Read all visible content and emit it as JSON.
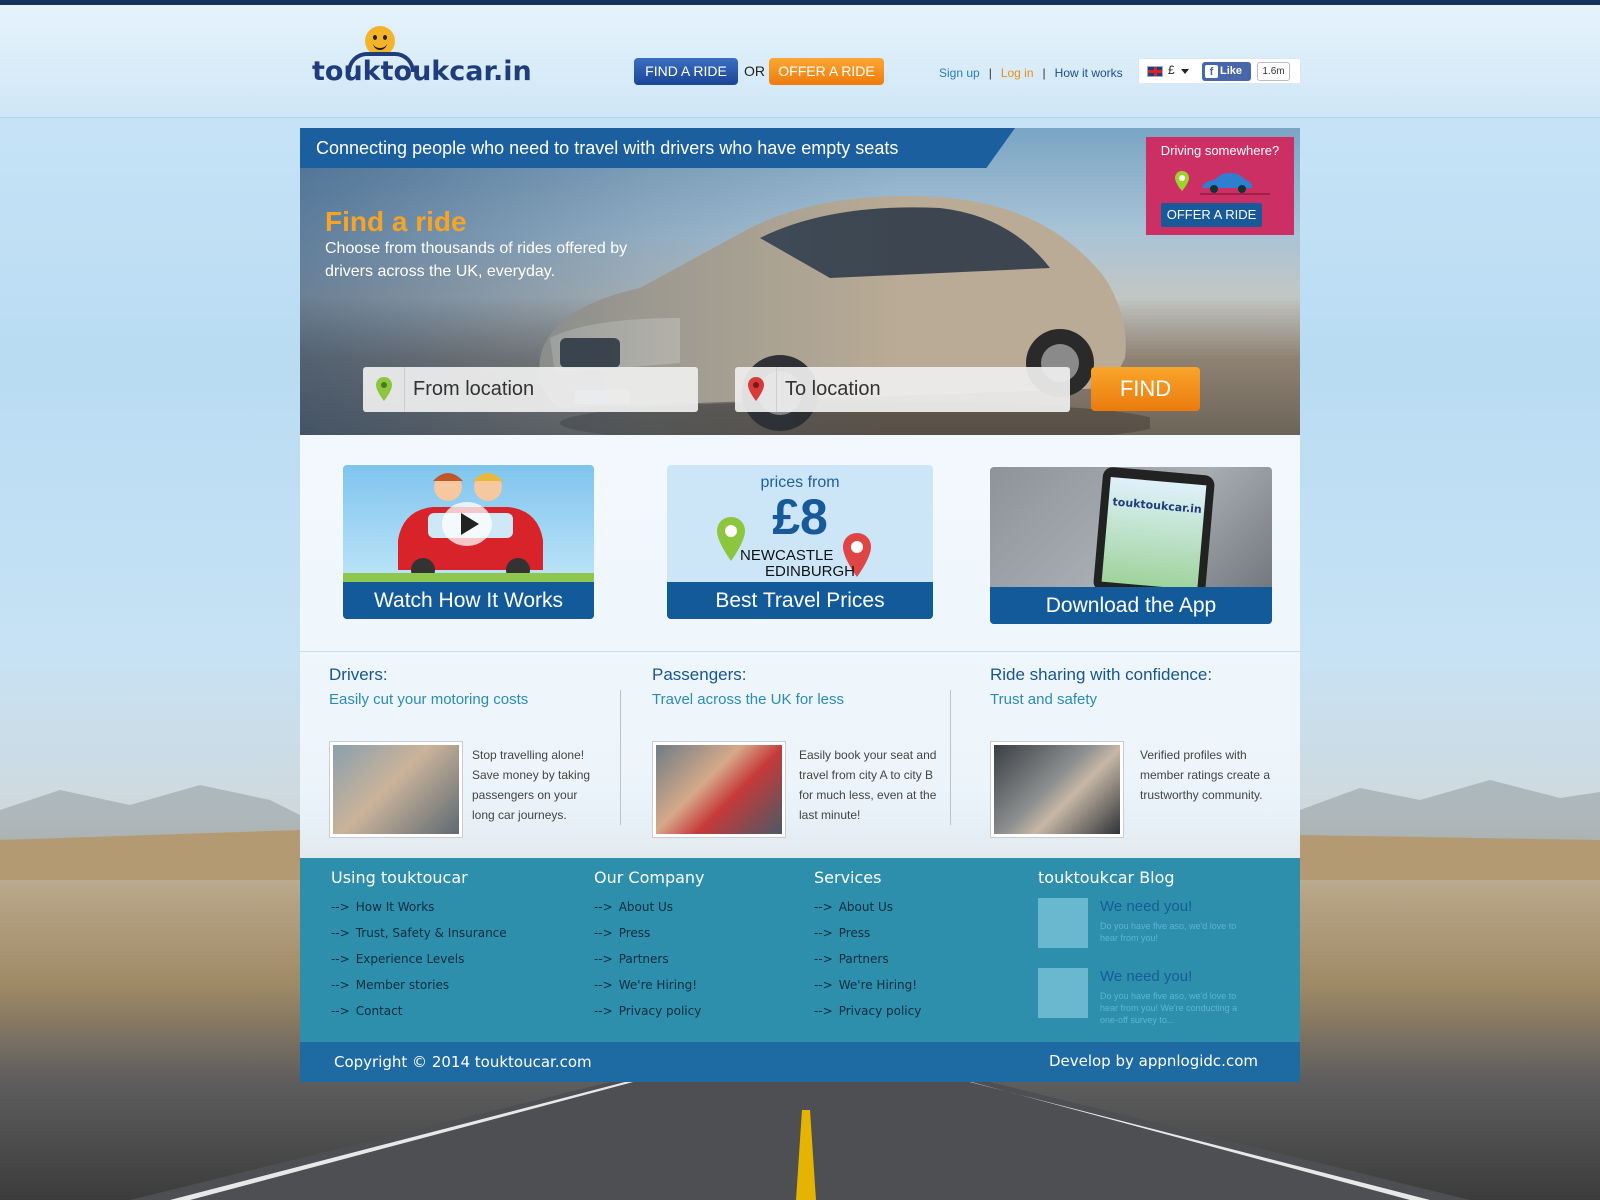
{
  "header": {
    "logo_text": "touktoukcar.in",
    "find_ride_label": "FIND A RIDE",
    "or_label": "OR",
    "offer_ride_label": "OFFER A RIDE",
    "nav": {
      "sign_up": "Sign up",
      "log_in": "Log in",
      "how_it_works": "How it works",
      "separator": "|"
    },
    "currency": "£",
    "fb_like": "Like",
    "fb_count": "1.6m"
  },
  "hero": {
    "banner": "Connecting people who need to travel with drivers who have empty seats",
    "find_title": "Find a ride",
    "find_subtitle": "Choose from thousands of rides offered by drivers across the UK, everyday.",
    "driving_box": {
      "title": "Driving somewhere?",
      "button": "OFFER A RIDE"
    },
    "search": {
      "from_placeholder": "From location",
      "to_placeholder": "To location",
      "button": "FIND"
    }
  },
  "features": [
    {
      "label": "Watch How It Works"
    },
    {
      "label": "Best Travel Prices",
      "prices_from": "prices from",
      "price": "£8",
      "city_from": "NEWCASTLE",
      "city_to": "EDINBURGH"
    },
    {
      "label": "Download the App",
      "app_logo": "touktoukcar.in"
    }
  ],
  "columns": [
    {
      "title": "Drivers:",
      "subtitle": "Easily cut your motoring costs",
      "text": "Stop travelling alone! Save money by taking passengers on your long car journeys."
    },
    {
      "title": "Passengers:",
      "subtitle": "Travel across the UK for less",
      "text": "Easily book your seat and travel from city A to city B for much less, even at the last minute!"
    },
    {
      "title": "Ride sharing with confidence:",
      "subtitle": "Trust and safety",
      "text": "Verified profiles with member ratings create a trustworthy community."
    }
  ],
  "footer": {
    "arrow": "-->",
    "using": {
      "title": "Using touktoucar",
      "items": [
        "How It Works",
        "Trust, Safety & Insurance",
        "Experience Levels",
        "Member stories",
        "Contact"
      ]
    },
    "company": {
      "title": "Our Company",
      "items": [
        "About Us",
        "Press",
        "Partners",
        "We're Hiring!",
        "Privacy policy"
      ]
    },
    "services": {
      "title": "Services",
      "items": [
        "About Us",
        "Press",
        "Partners",
        "We're Hiring!",
        "Privacy policy"
      ]
    },
    "blog": {
      "title": "touktoukcar Blog",
      "posts": [
        {
          "title": "We need you!",
          "text": "Do you have five aso, we'd love to hear from you!"
        },
        {
          "title": "We need you!",
          "text": "Do you have five aso, we'd love to hear from you! We're conducting a one-off survey to..."
        }
      ]
    },
    "copyright": "Copyright © 2014 touktoucar.com",
    "developer": "Develop by  appnlogidc.com"
  },
  "colors": {
    "brand_blue": "#135a9b",
    "accent_orange": "#f6a425",
    "offer_pink": "#cc2f63",
    "footer_teal": "#2d8fac"
  }
}
